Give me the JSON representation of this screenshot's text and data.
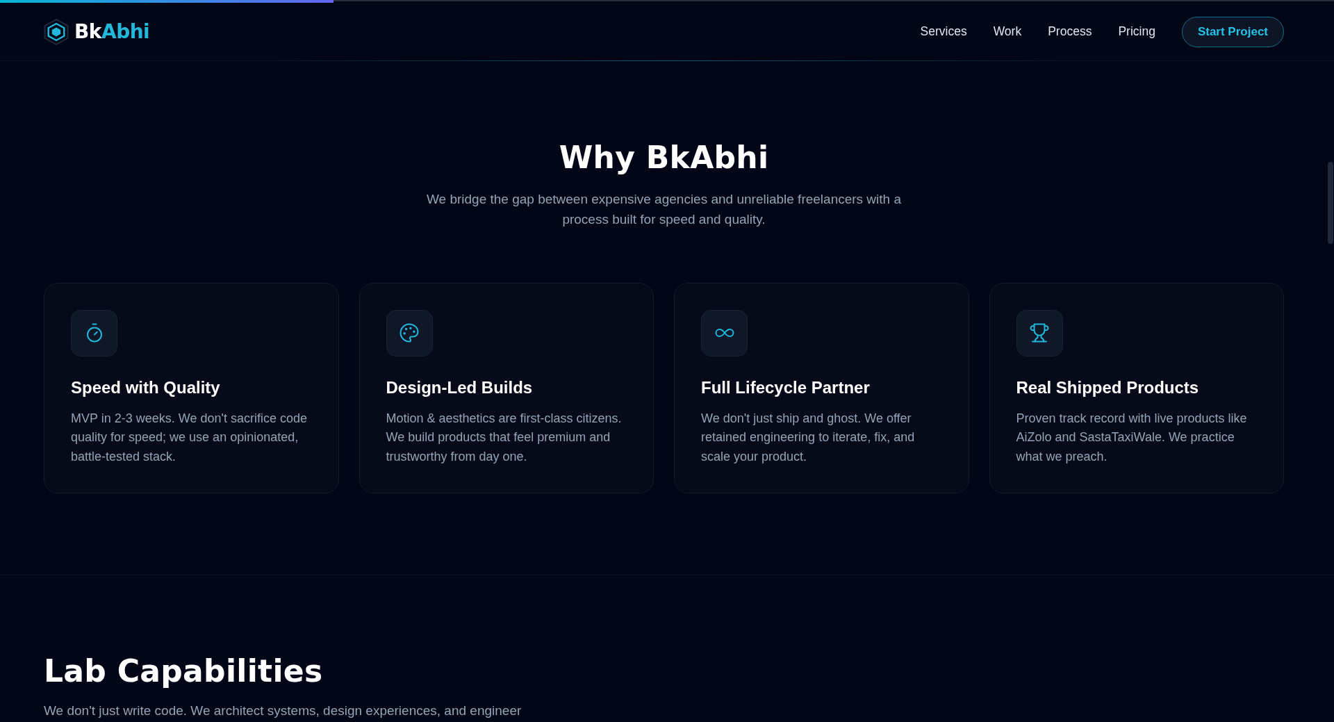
{
  "reading_progress": {
    "level": 0.25
  },
  "navbar": {
    "logo": {
      "parts": [
        {
          "text": "Bk",
          "kind": "base"
        },
        {
          "text": "Abhi",
          "kind": "accent"
        }
      ]
    },
    "links": [
      {
        "label": "Services"
      },
      {
        "label": "Work"
      },
      {
        "label": "Process"
      },
      {
        "label": "Pricing"
      }
    ],
    "cta_button": "Start Project"
  },
  "why_section": {
    "title": "Why BkAbhi",
    "subtitle": "We bridge the gap between expensive agencies and unreliable freelancers with a process built for speed and quality.",
    "cards": [
      {
        "title": "Speed with Quality",
        "text": "MVP in 2-3 weeks. We don't sacrifice code quality for speed; we use an opinionated, battle-tested stack."
      },
      {
        "title": "Design-Led Builds",
        "text": "Motion & aesthetics are first-class citizens. We build products that feel premium and trustworthy from day one."
      },
      {
        "title": "Full Lifecycle Partner",
        "text": "We don't just ship and ghost. We offer retained engineering to iterate, fix, and scale your product."
      },
      {
        "title": "Real Shipped Products",
        "text": "Proven track record with live products like AiZolo and SastaTaxiWale. We practice what we preach."
      }
    ]
  },
  "lab_section": {
    "title": "Lab Capabilities",
    "subtitle": "We don't just write code. We architect systems, design experiences, and engineer"
  }
}
